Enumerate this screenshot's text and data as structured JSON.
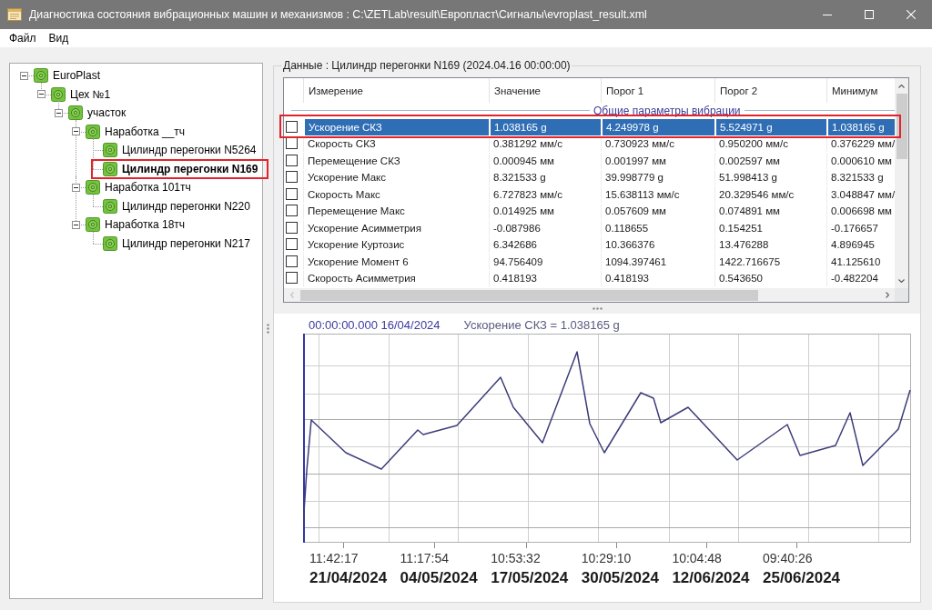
{
  "window": {
    "title": "Диагностика состояния вибрационных машин и механизмов : C:\\ZETLab\\result\\Европласт\\Сигналы\\evroplast_result.xml"
  },
  "menu": [
    "Файл",
    "Вид"
  ],
  "tree": [
    {
      "label": "EuroPlast",
      "expanded": true,
      "selected": false,
      "highlighted": false,
      "children": [
        {
          "label": "Цех №1",
          "expanded": true,
          "selected": false,
          "highlighted": false,
          "children": [
            {
              "label": "участок",
              "expanded": true,
              "selected": false,
              "highlighted": false,
              "children": [
                {
                  "label": "Наработка __тч",
                  "expanded": true,
                  "selected": false,
                  "highlighted": false,
                  "children": [
                    {
                      "label": "Цилиндр перегонки N5264",
                      "selected": false,
                      "highlighted": false
                    },
                    {
                      "label": "Цилиндр перегонки N169",
                      "selected": true,
                      "highlighted": true
                    }
                  ]
                },
                {
                  "label": "Наработка 101тч",
                  "expanded": true,
                  "selected": false,
                  "highlighted": false,
                  "children": [
                    {
                      "label": "Цилиндр перегонки N220",
                      "selected": false,
                      "highlighted": false
                    }
                  ]
                },
                {
                  "label": "Наработка 18тч",
                  "expanded": true,
                  "selected": false,
                  "highlighted": false,
                  "children": [
                    {
                      "label": "Цилиндр перегонки N217",
                      "selected": false,
                      "highlighted": false
                    }
                  ]
                }
              ]
            }
          ]
        }
      ]
    }
  ],
  "data_panel": {
    "title": "Данные : Цилиндр перегонки N169 (2024.04.16 00:00:00)",
    "table": {
      "columns": [
        "Измерение",
        "Значение",
        "Порог 1",
        "Порог 2",
        "Минимум"
      ],
      "group": "Общие параметры вибрации",
      "rows": [
        {
          "checked": false,
          "selected": true,
          "highlighted": true,
          "cells": [
            "Ускорение СКЗ",
            "1.038165 g",
            "4.249978 g",
            "5.524971 g",
            "1.038165 g"
          ]
        },
        {
          "checked": false,
          "selected": false,
          "highlighted": false,
          "cells": [
            "Скорость СКЗ",
            "0.381292 мм/с",
            "0.730923 мм/с",
            "0.950200 мм/с",
            "0.376229 мм/"
          ]
        },
        {
          "checked": false,
          "selected": false,
          "highlighted": false,
          "cells": [
            "Перемещение СКЗ",
            "0.000945 мм",
            "0.001997 мм",
            "0.002597 мм",
            "0.000610 мм"
          ]
        },
        {
          "checked": false,
          "selected": false,
          "highlighted": false,
          "cells": [
            "Ускорение Макс",
            "8.321533 g",
            "39.998779 g",
            "51.998413 g",
            "8.321533 g"
          ]
        },
        {
          "checked": false,
          "selected": false,
          "highlighted": false,
          "cells": [
            "Скорость Макс",
            "6.727823 мм/с",
            "15.638113 мм/с",
            "20.329546 мм/с",
            "3.048847 мм/"
          ]
        },
        {
          "checked": false,
          "selected": false,
          "highlighted": false,
          "cells": [
            "Перемещение Макс",
            "0.014925 мм",
            "0.057609 мм",
            "0.074891 мм",
            "0.006698 мм"
          ]
        },
        {
          "checked": false,
          "selected": false,
          "highlighted": false,
          "cells": [
            "Ускорение Асимметрия",
            "-0.087986",
            "0.118655",
            "0.154251",
            "-0.176657"
          ]
        },
        {
          "checked": false,
          "selected": false,
          "highlighted": false,
          "cells": [
            "Ускорение Куртозис",
            "6.342686",
            "10.366376",
            "13.476288",
            "4.896945"
          ]
        },
        {
          "checked": false,
          "selected": false,
          "highlighted": false,
          "cells": [
            "Ускорение Момент 6",
            "94.756409",
            "1094.397461",
            "1422.716675",
            "41.125610"
          ]
        },
        {
          "checked": false,
          "selected": false,
          "highlighted": false,
          "cells": [
            "Скорость Асимметрия",
            "0.418193",
            "0.418193",
            "0.543650",
            "-0.482204"
          ]
        }
      ]
    }
  },
  "chart": {
    "cursor": "00:00:00.000 16/04/2024",
    "readout": "Ускорение СКЗ = 1.038165 g",
    "x_labels": [
      {
        "time": "11:42:17",
        "date": "21/04/2024"
      },
      {
        "time": "11:17:54",
        "date": "04/05/2024"
      },
      {
        "time": "10:53:32",
        "date": "17/05/2024"
      },
      {
        "time": "10:29:10",
        "date": "30/05/2024"
      },
      {
        "time": "10:04:48",
        "date": "12/06/2024"
      },
      {
        "time": "09:40:26",
        "date": "25/06/2024"
      }
    ]
  }
}
